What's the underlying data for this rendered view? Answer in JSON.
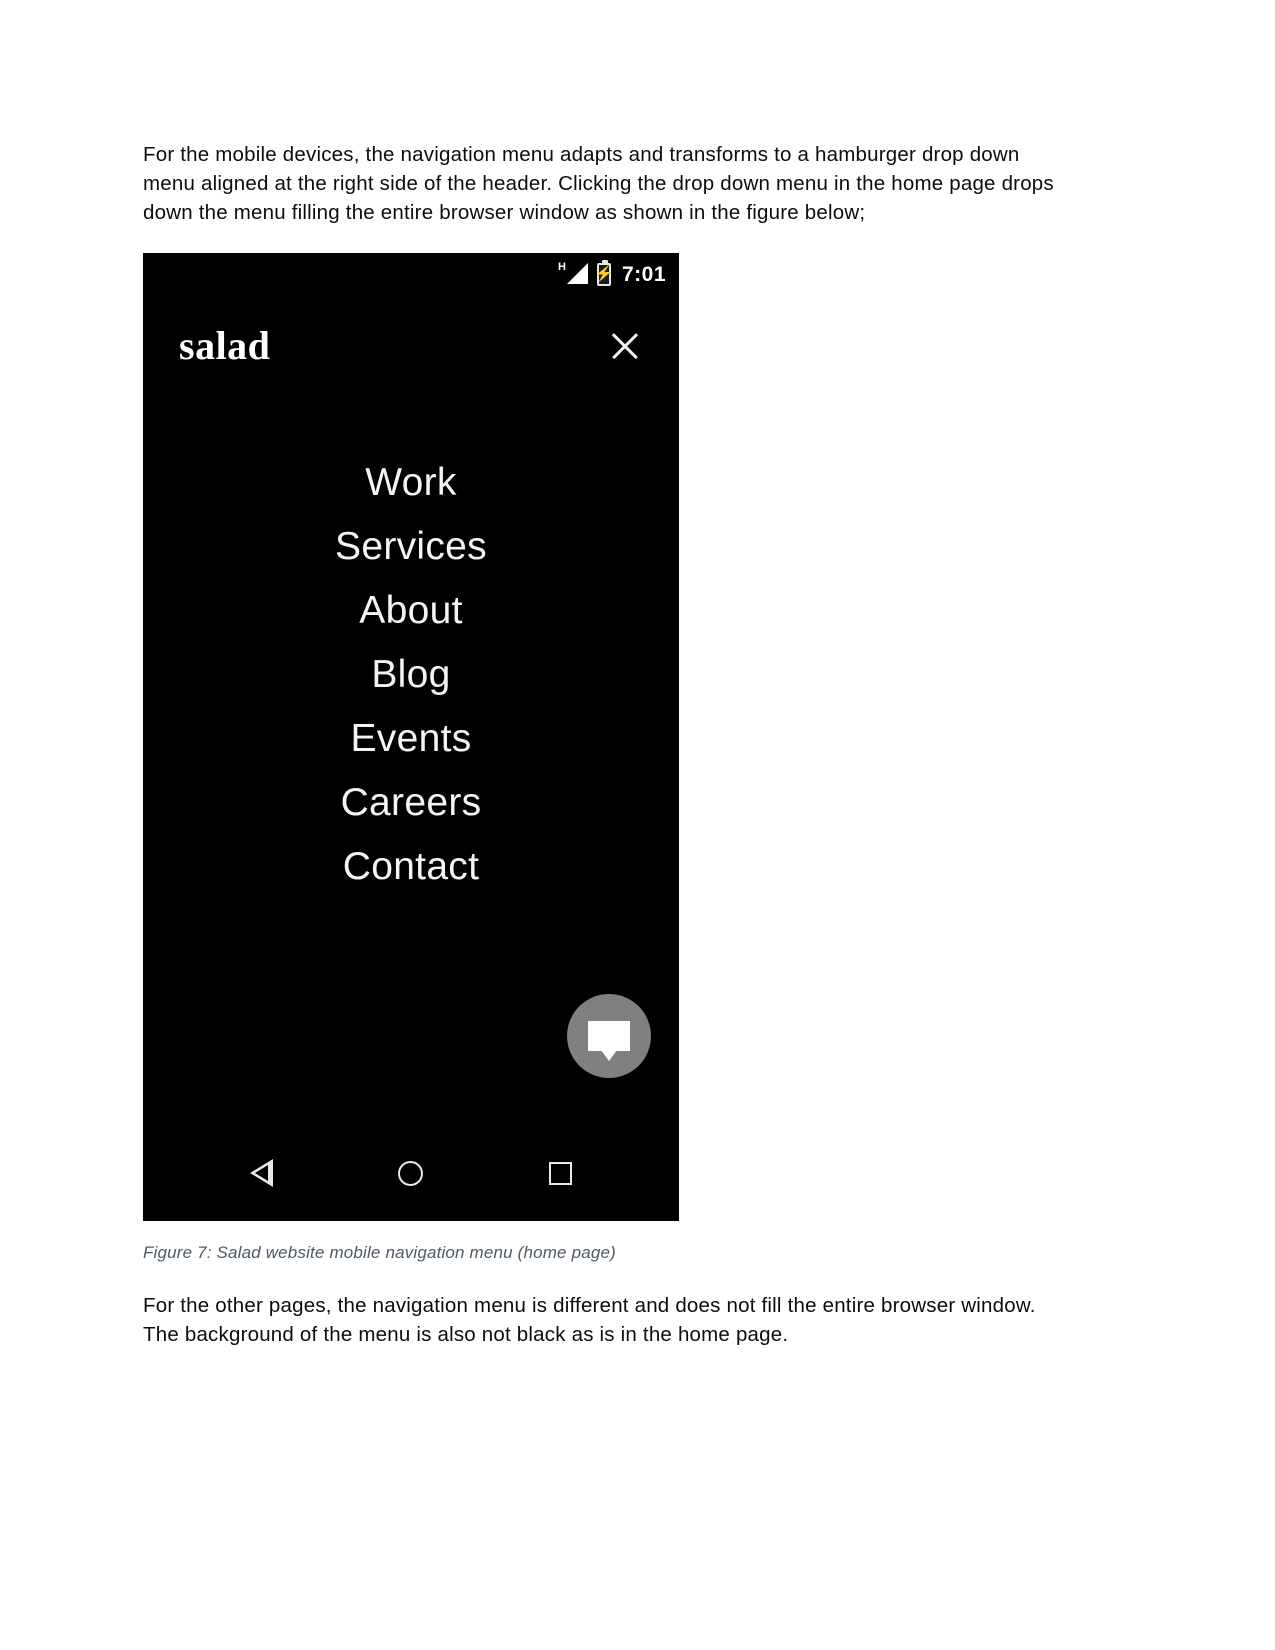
{
  "document": {
    "intro_paragraph": "For the mobile devices, the navigation menu adapts and transforms to a hamburger drop down menu aligned at the right side of the header. Clicking the drop down menu in the home page drops down the menu filling the entire browser window as shown in the figure below;",
    "figure_caption": "Figure 7: Salad website mobile navigation menu (home page)",
    "outro_paragraph": "For the other pages, the navigation menu is different and does not fill the entire browser window. The background of the menu is also not black as is in the home page."
  },
  "phone": {
    "status_bar": {
      "network_type": "H",
      "signal_icon": "signal-triangle-icon",
      "battery_icon": "battery-charging-icon",
      "time": "7:01"
    },
    "header": {
      "brand": "salad",
      "close_icon": "close-x-icon"
    },
    "nav_menu": [
      {
        "label": "Work"
      },
      {
        "label": "Services"
      },
      {
        "label": "About"
      },
      {
        "label": "Blog"
      },
      {
        "label": "Events"
      },
      {
        "label": "Careers"
      },
      {
        "label": "Contact"
      }
    ],
    "chat_button": {
      "icon": "chat-bubble-icon",
      "background_color": "#808080"
    },
    "android_nav": [
      {
        "icon": "back-triangle-icon"
      },
      {
        "icon": "home-circle-icon"
      },
      {
        "icon": "recents-square-icon"
      }
    ],
    "colors": {
      "screen_background": "#000000",
      "text": "#f4f4f4",
      "accent": "#808080"
    }
  }
}
